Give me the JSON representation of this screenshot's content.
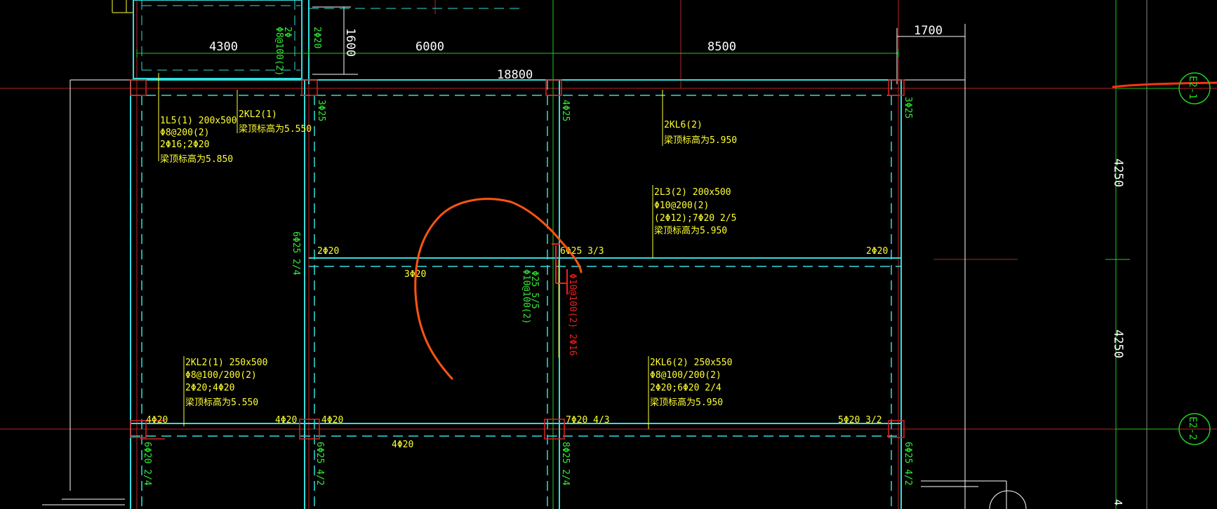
{
  "dimensions": {
    "d4300": "4300",
    "d6000": "6000",
    "d8500": "8500",
    "d18800": "18800",
    "d1700": "1700",
    "d1600": "1600",
    "d4250_top": "4250",
    "d4250_bottom": "4250"
  },
  "axes": {
    "e2_1": "E2-1",
    "e2_2": "E2-2"
  },
  "beams": {
    "l1": {
      "l1": "1L5(1) 200x500",
      "l2": "Φ8@200(2)",
      "l3": "2Φ16;2Φ20",
      "l4": "梁顶标高为5.850"
    },
    "kl2_top": {
      "l1": "2KL2(1)",
      "l2": "梁顶标高为5.550"
    },
    "kl6_top": {
      "l1": "2KL6(2)",
      "l2": "梁顶标高为5.950"
    },
    "l3": {
      "l1": "2L3(2) 200x500",
      "l2": "Φ10@200(2)",
      "l3": "(2Φ12);7Φ20 2/5",
      "l4": "梁顶标高为5.950"
    },
    "kl2_bot": {
      "l1": "2KL2(1) 250x500",
      "l2": "Φ8@100/200(2)",
      "l3": "2Φ20;4Φ20",
      "l4": "梁顶标高为5.550"
    },
    "kl6_bot": {
      "l1": "2KL6(2) 250x550",
      "l2": "Φ8@100/200(2)",
      "l3": "2Φ20;6Φ20 2/4",
      "l4": "梁顶标高为5.950"
    }
  },
  "rebar_labels": {
    "mid_left": "2Φ20",
    "mid_3phi": "3Φ20",
    "mid_6phi": "6Φ25 3/3",
    "mid_right": "2Φ20",
    "bot_4a": "4Φ20",
    "bot_4b": "4Φ20",
    "bot_4c": "4Φ20",
    "bot_4d": "4Φ20",
    "bot_7": "7Φ20 4/3",
    "bot_5": "5Φ20 3/2"
  },
  "vertical_labels": {
    "v_3phi25_a": "3Φ25",
    "v_4phi25": "4Φ25",
    "v_3phi25_b": "3Φ25",
    "v_top_stirrup": "Φ8@100(2)",
    "v_top_2phi": "2Φ",
    "v_top_phi20": "2Φ20",
    "v_6phi25_24": "6Φ25 2/4",
    "v_mid_stirrup": "Φ10@100(2)",
    "v_mid_phi25": "Φ25 5/5",
    "v_red": "Φ10@100(2) 2Φ16",
    "v_bot_left": "6Φ20 2/4",
    "v_bot_2": "6Φ25 4/2",
    "v_bot_3": "8Φ25 2/4",
    "v_bot_4": "6Φ25 4/2"
  },
  "colors": {
    "background": "#000000",
    "cyan_beam": "#33dddd",
    "rebar_green": "#33ee33",
    "annotation_yellow": "#ffff33",
    "dimension_white": "#ffffff",
    "axis_green": "#22cc22",
    "column_red": "#dd2222",
    "markup_orange": "#ff5511"
  }
}
